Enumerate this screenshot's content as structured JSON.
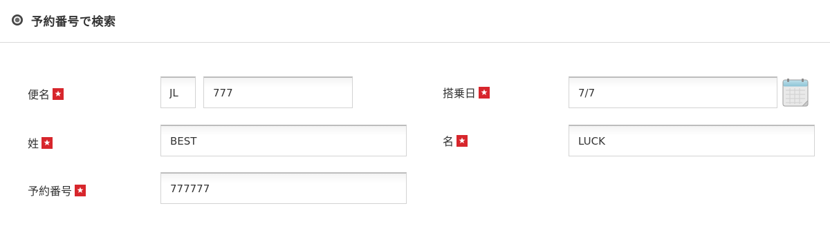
{
  "section": {
    "title": "予約番号で検索"
  },
  "fields": {
    "flight": {
      "label": "便名",
      "airline_code": "JL",
      "number": "777"
    },
    "boarding_date": {
      "label": "搭乗日",
      "value": "7/7"
    },
    "last_name": {
      "label": "姓",
      "value": "BEST"
    },
    "first_name": {
      "label": "名",
      "value": "LUCK"
    },
    "reservation_number": {
      "label": "予約番号",
      "value": "777777"
    }
  },
  "colors": {
    "required_badge": "#d7262c",
    "divider": "#d9d9d9",
    "text": "#333333"
  }
}
